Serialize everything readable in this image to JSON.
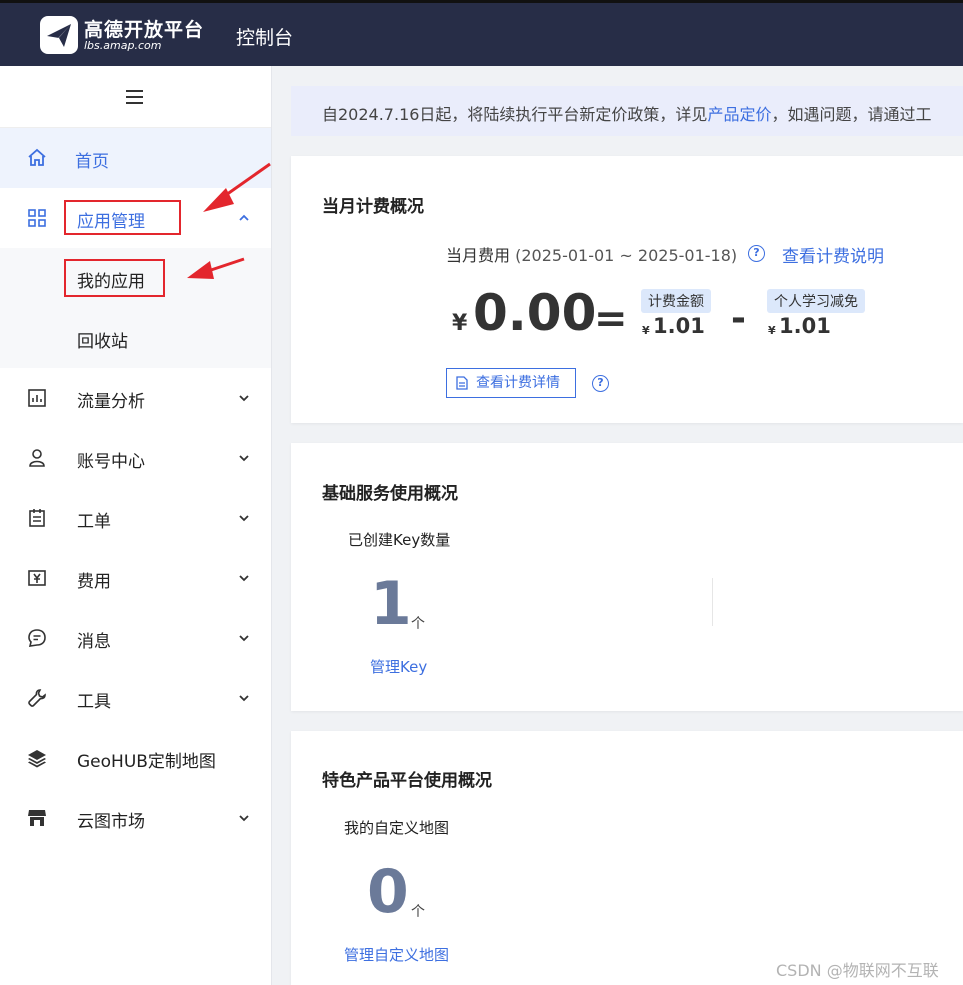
{
  "header": {
    "brand_name": "高德开放平台",
    "brand_domain": "lbs.amap.com",
    "console_title": "控制台"
  },
  "sidebar": {
    "items": [
      {
        "label": "首页",
        "icon": "home-icon"
      },
      {
        "label": "应用管理",
        "icon": "apps-grid-icon"
      },
      {
        "label": "我的应用"
      },
      {
        "label": "回收站"
      },
      {
        "label": "流量分析",
        "icon": "chart-icon"
      },
      {
        "label": "账号中心",
        "icon": "user-icon"
      },
      {
        "label": "工单",
        "icon": "clipboard-icon"
      },
      {
        "label": "费用",
        "icon": "yen-icon"
      },
      {
        "label": "消息",
        "icon": "message-icon"
      },
      {
        "label": "工具",
        "icon": "wrench-icon"
      },
      {
        "label": "GeoHUB定制地图",
        "icon": "layers-icon"
      },
      {
        "label": "云图市场",
        "icon": "store-icon"
      }
    ]
  },
  "notice": {
    "text_before": "自2024.7.16日起，将陆续执行平台新定价政策，详见",
    "link": "产品定价",
    "text_after": "，如遇问题，请通过工"
  },
  "billing": {
    "title": "当月计费概况",
    "period_label": "当月费用",
    "period_range": "(2025-01-01 ~ 2025-01-18)",
    "help_link": "查看计费说明",
    "currency": "¥",
    "total": "0.00",
    "equals": "=",
    "minus": "-",
    "charge_label": "计费金额",
    "charge_value": "1.01",
    "discount_label": "个人学习减免",
    "discount_value": "1.01",
    "detail_button": "查看计费详情",
    "help_glyph": "?"
  },
  "basic_services": {
    "title": "基础服务使用概况",
    "stat_label": "已创建Key数量",
    "stat_value": "1",
    "stat_unit": "个",
    "stat_link": "管理Key"
  },
  "featured": {
    "title": "特色产品平台使用概况",
    "stat_label": "我的自定义地图",
    "stat_value": "0",
    "stat_unit": "个",
    "stat_link": "管理自定义地图"
  },
  "watermark": "CSDN @物联网不互联",
  "colors": {
    "header_bg": "#272d47",
    "accent": "#3d6fe0",
    "annotation_red": "#e3262d"
  }
}
